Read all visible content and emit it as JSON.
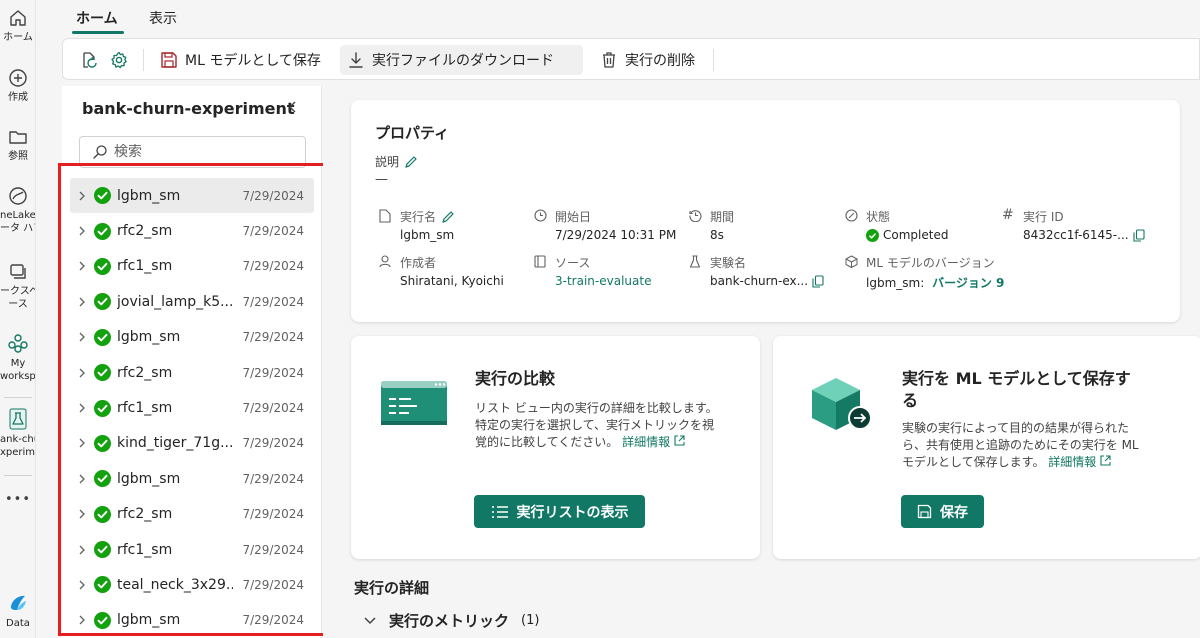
{
  "rail": {
    "home": "ホーム",
    "create": "作成",
    "browse": "参照",
    "onelake": [
      "neLake デ",
      "ータ ハブ"
    ],
    "workspaces": [
      "ークスペ",
      "ース"
    ],
    "myworkspace": [
      "My",
      "workspace"
    ],
    "experiment": [
      "ank-churn-",
      "xperiment"
    ],
    "more": "•••",
    "data": "Data"
  },
  "tabs": {
    "home": "ホーム",
    "view": "表示"
  },
  "toolbar": {
    "save_model": "ML モデルとして保存",
    "download": "実行ファイルのダウンロード",
    "delete": "実行の削除"
  },
  "panel": {
    "title": "bank-churn-experiment",
    "search_placeholder": "検索",
    "runs": [
      {
        "name": "lgbm_sm",
        "date": "7/29/2024"
      },
      {
        "name": "rfc2_sm",
        "date": "7/29/2024"
      },
      {
        "name": "rfc1_sm",
        "date": "7/29/2024"
      },
      {
        "name": "jovial_lamp_k5...",
        "date": "7/29/2024"
      },
      {
        "name": "lgbm_sm",
        "date": "7/29/2024"
      },
      {
        "name": "rfc2_sm",
        "date": "7/29/2024"
      },
      {
        "name": "rfc1_sm",
        "date": "7/29/2024"
      },
      {
        "name": "kind_tiger_71g...",
        "date": "7/29/2024"
      },
      {
        "name": "lgbm_sm",
        "date": "7/29/2024"
      },
      {
        "name": "rfc2_sm",
        "date": "7/29/2024"
      },
      {
        "name": "rfc1_sm",
        "date": "7/29/2024"
      },
      {
        "name": "teal_neck_3x29...",
        "date": "7/29/2024"
      },
      {
        "name": "lgbm_sm",
        "date": "7/29/2024"
      }
    ]
  },
  "properties": {
    "title": "プロパティ",
    "description_label": "説明",
    "description_value": "—",
    "run_name_label": "実行名",
    "run_name": "lgbm_sm",
    "start_label": "開始日",
    "start": "7/29/2024 10:31 PM",
    "duration_label": "期間",
    "duration": "8s",
    "status_label": "状態",
    "status": "Completed",
    "run_id_label": "実行 ID",
    "run_id": "8432cc1f-6145-...",
    "creator_label": "作成者",
    "creator": "Shiratani, Kyoichi",
    "source_label": "ソース",
    "source": "3-train-evaluate",
    "experiment_label": "実験名",
    "experiment": "bank-churn-ex...",
    "model_version_label": "ML モデルのバージョン",
    "model_version_prefix": "lgbm_sm: ",
    "model_version_link": "バージョン 9"
  },
  "compare": {
    "title": "実行の比較",
    "text1": "リスト ビュー内の実行の詳細を比較します。",
    "text2": "特定の実行を選択して、実行メトリックを視",
    "text3": "覚的に比較してください。",
    "more": "詳細情報",
    "button": "実行リストの表示"
  },
  "save_model": {
    "title1": "実行を ML モデルとして保存す",
    "title2": "る",
    "text1": "実験の実行によって目的の結果が得られた",
    "text2": "ら、共有使用と追跡のためにその実行を ML",
    "text3": "モデルとして保存します。",
    "more": "詳細情報",
    "button": "保存"
  },
  "details": {
    "title": "実行の詳細",
    "metrics": "実行のメトリック",
    "metrics_count": "(1)"
  },
  "colors": {
    "accent": "#117865",
    "success": "#13a10e",
    "highlight": "#e51f1f"
  }
}
